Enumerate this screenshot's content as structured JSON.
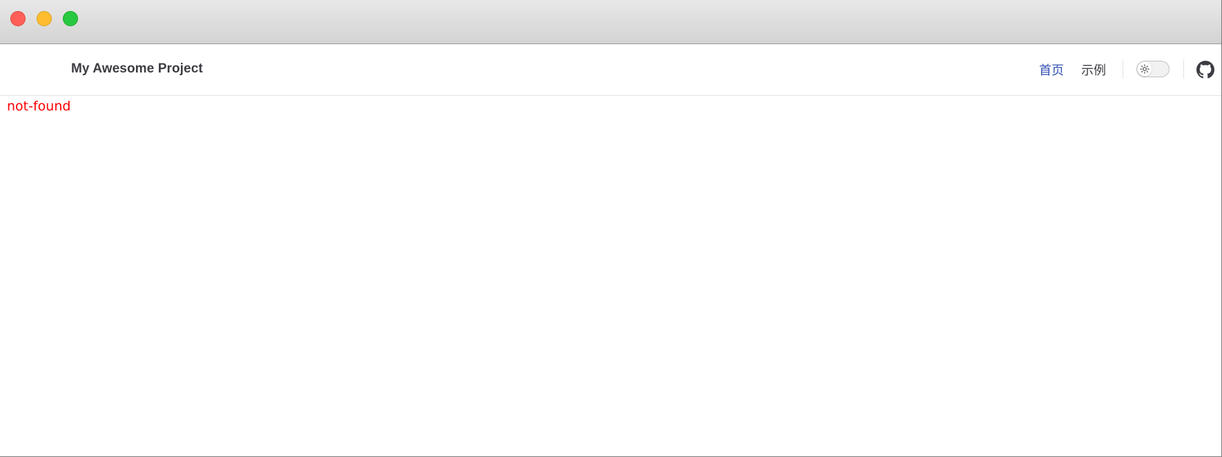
{
  "window": {
    "controls": [
      "close",
      "minimize",
      "maximize"
    ]
  },
  "navbar": {
    "brand": "My Awesome Project",
    "links": [
      {
        "label": "首页",
        "active": true
      },
      {
        "label": "示例",
        "active": false
      }
    ],
    "theme_toggle_icon": "sun-icon",
    "social_icon": "github-icon",
    "colors": {
      "text": "#3c3c43",
      "active_link": "#3451b2"
    }
  },
  "main": {
    "message": "not-found",
    "message_color": "#ff0000"
  }
}
